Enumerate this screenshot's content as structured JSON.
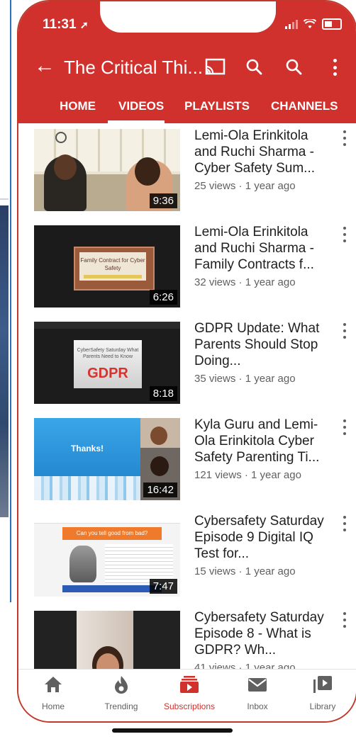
{
  "status_bar": {
    "time": "11:31"
  },
  "app_bar": {
    "title": "The Critical Thi..."
  },
  "tabs": [
    {
      "label": "HOME"
    },
    {
      "label": "VIDEOS"
    },
    {
      "label": "PLAYLISTS"
    },
    {
      "label": "CHANNELS"
    }
  ],
  "videos": [
    {
      "title": "Lemi-Ola Erinkitola and Ruchi Sharma - Cyber Safety Sum...",
      "meta": "25 views · 1 year ago",
      "duration": "9:36"
    },
    {
      "title": "Lemi-Ola Erinkitola and Ruchi Sharma - Family Contracts f...",
      "meta": "32 views · 1 year ago",
      "duration": "6:26",
      "thumb_text": "Family Contract for Cyber Safety"
    },
    {
      "title": "GDPR Update: What Parents Should Stop Doing...",
      "meta": "35 views · 1 year ago",
      "duration": "8:18",
      "thumb_text": "CyberSafety Saturday What Parents Need to Know",
      "thumb_word": "GDPR"
    },
    {
      "title": "Kyla Guru and Lemi-Ola Erinkitola  Cyber Safety Parenting Ti...",
      "meta": "121 views · 1 year ago",
      "duration": "16:42",
      "thumb_text": "Thanks!"
    },
    {
      "title": "Cybersafety Saturday Episode 9 Digital IQ Test for...",
      "meta": "15 views · 1 year ago",
      "duration": "7:47",
      "thumb_text": "Can you tell good from bad?"
    },
    {
      "title": "Cybersafety Saturday Episode 8 - What is GDPR? Wh...",
      "meta": "41 views · 1 year ago",
      "duration": ""
    }
  ],
  "bottom_nav": [
    {
      "label": "Home",
      "icon": "home-icon"
    },
    {
      "label": "Trending",
      "icon": "flame-icon"
    },
    {
      "label": "Subscriptions",
      "icon": "subscriptions-icon"
    },
    {
      "label": "Inbox",
      "icon": "mail-icon"
    },
    {
      "label": "Library",
      "icon": "library-icon"
    }
  ],
  "colors": {
    "brand": "#d0312d",
    "active_nav": "#d0312d",
    "text": "#1f1f1f",
    "meta": "#606060"
  }
}
